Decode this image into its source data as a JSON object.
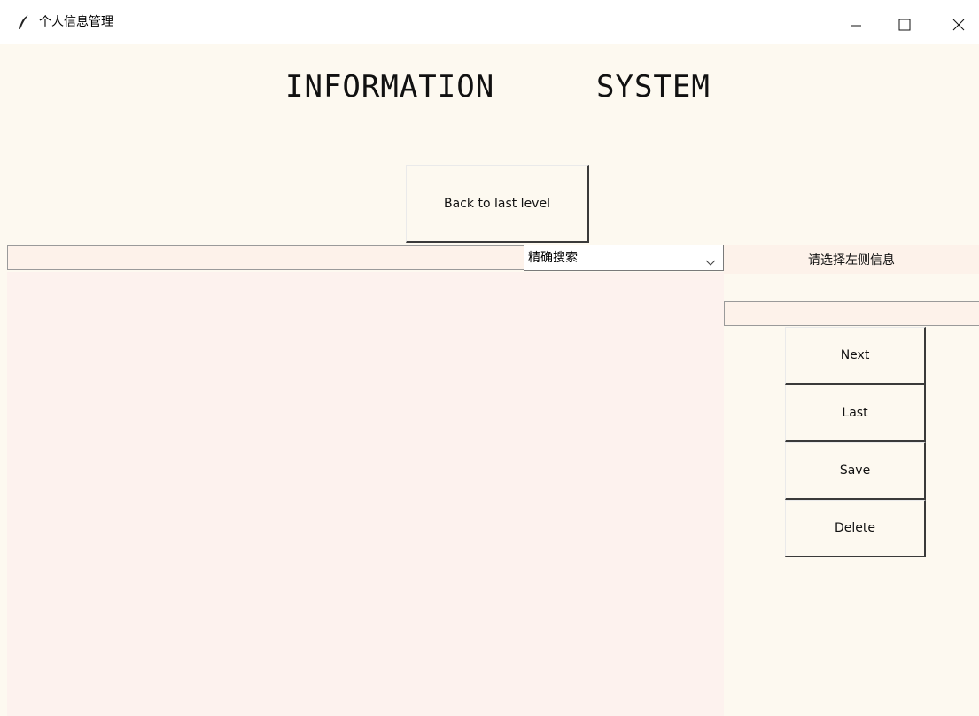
{
  "window": {
    "title": "个人信息管理",
    "icons": {
      "app": "feather-icon",
      "minimize": "minimize-icon",
      "maximize": "maximize-icon",
      "close": "close-icon"
    }
  },
  "header": {
    "word1": "INFORMATION",
    "word2": "SYSTEM"
  },
  "nav": {
    "back_label": "Back to last level"
  },
  "search": {
    "query": "",
    "mode_selected": "精确搜索"
  },
  "side_panel": {
    "prompt": "请选择左侧信息",
    "detail_value": ""
  },
  "actions": {
    "next_label": "Next",
    "last_label": "Last",
    "save_label": "Save",
    "delete_label": "Delete"
  },
  "colors": {
    "window_bg": "#fdf9f0",
    "list_bg": "#fdf2ee",
    "input_bg": "#fdf2ea"
  }
}
